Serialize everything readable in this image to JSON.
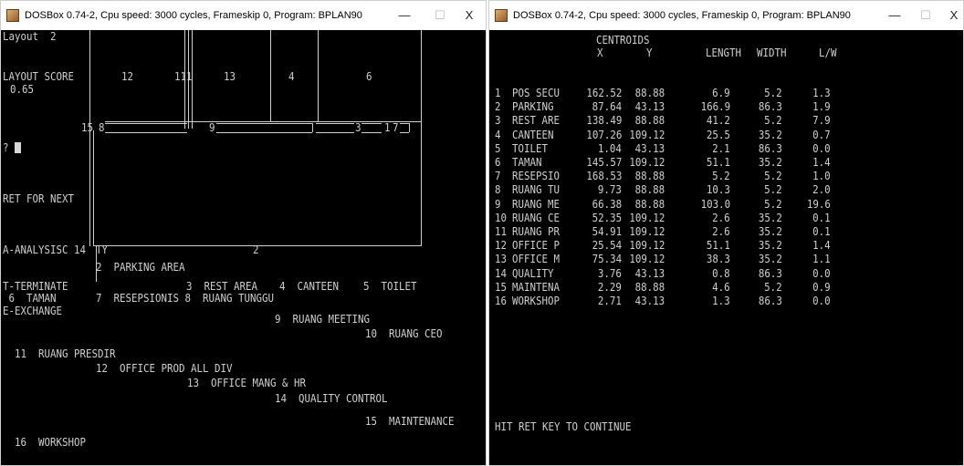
{
  "left_window": {
    "title": "DOSBox 0.74-2, Cpu speed:   3000 cycles, Frameskip  0, Program:   BPLAN90",
    "buttons": {
      "minimize": "—",
      "maximize": "☐",
      "close": "X"
    },
    "layout_label": "Layout  2",
    "score_label": "LAYOUT SCORE",
    "score_value": "0.65",
    "prompt": "?",
    "ret_for_next": "RET FOR NEXT",
    "analysis": "A-ANALYSISC 14",
    "terminate": "T-TERMINATE",
    "taman": " 6  TAMAN",
    "exchange": "E-EXCHANGE",
    "block_labels": {
      "b12": "12",
      "b111": "111",
      "b13": "13",
      "b4": "4",
      "b6": "6",
      "n15": "15",
      "n8": "8",
      "n9": "9",
      "n3": "3",
      "n1": "1",
      "n7": "7",
      "ty": "TY",
      "two": "2"
    },
    "legend": [
      "2  PARKING AREA",
      "3  REST AREA",
      "4  CANTEEN",
      "5  TOILET",
      "7  RESEPSIONIS 8  RUANG TUNGGU",
      "9  RUANG MEETING",
      "10  RUANG CEO",
      "11  RUANG PRESDIR",
      "12  OFFICE PROD ALL DIV",
      "13  OFFICE MANG & HR",
      "14  QUALITY CONTROL",
      "15  MAINTENANCE",
      "16  WORKSHOP"
    ]
  },
  "right_window": {
    "title": "DOSBox 0.74-2, Cpu speed:   3000 cycles, Frameskip  0, Program:   BPLAN90",
    "buttons": {
      "minimize": "—",
      "maximize": "☐",
      "close": "X"
    },
    "centroids_label": "CENTROIDS",
    "headers": {
      "x": "X",
      "y": "Y",
      "length": "LENGTH",
      "width": "WIDTH",
      "lw": "L/W"
    },
    "rows": [
      {
        "no": "1",
        "name": "POS SECU",
        "x": "162.52",
        "y": "88.88",
        "length": "6.9",
        "width": "5.2",
        "lw": "1.3"
      },
      {
        "no": "2",
        "name": "PARKING",
        "x": "87.64",
        "y": "43.13",
        "length": "166.9",
        "width": "86.3",
        "lw": "1.9"
      },
      {
        "no": "3",
        "name": "REST ARE",
        "x": "138.49",
        "y": "88.88",
        "length": "41.2",
        "width": "5.2",
        "lw": "7.9"
      },
      {
        "no": "4",
        "name": "CANTEEN",
        "x": "107.26",
        "y": "109.12",
        "length": "25.5",
        "width": "35.2",
        "lw": "0.7"
      },
      {
        "no": "5",
        "name": "TOILET",
        "x": "1.04",
        "y": "43.13",
        "length": "2.1",
        "width": "86.3",
        "lw": "0.0"
      },
      {
        "no": "6",
        "name": "TAMAN",
        "x": "145.57",
        "y": "109.12",
        "length": "51.1",
        "width": "35.2",
        "lw": "1.4"
      },
      {
        "no": "7",
        "name": "RESEPSIO",
        "x": "168.53",
        "y": "88.88",
        "length": "5.2",
        "width": "5.2",
        "lw": "1.0"
      },
      {
        "no": "8",
        "name": "RUANG TU",
        "x": "9.73",
        "y": "88.88",
        "length": "10.3",
        "width": "5.2",
        "lw": "2.0"
      },
      {
        "no": "9",
        "name": "RUANG ME",
        "x": "66.38",
        "y": "88.88",
        "length": "103.0",
        "width": "5.2",
        "lw": "19.6"
      },
      {
        "no": "10",
        "name": "RUANG CE",
        "x": "52.35",
        "y": "109.12",
        "length": "2.6",
        "width": "35.2",
        "lw": "0.1"
      },
      {
        "no": "11",
        "name": "RUANG PR",
        "x": "54.91",
        "y": "109.12",
        "length": "2.6",
        "width": "35.2",
        "lw": "0.1"
      },
      {
        "no": "12",
        "name": "OFFICE P",
        "x": "25.54",
        "y": "109.12",
        "length": "51.1",
        "width": "35.2",
        "lw": "1.4"
      },
      {
        "no": "13",
        "name": "OFFICE M",
        "x": "75.34",
        "y": "109.12",
        "length": "38.3",
        "width": "35.2",
        "lw": "1.1"
      },
      {
        "no": "14",
        "name": "QUALITY",
        "x": "3.76",
        "y": "43.13",
        "length": "0.8",
        "width": "86.3",
        "lw": "0.0"
      },
      {
        "no": "15",
        "name": "MAINTENA",
        "x": "2.29",
        "y": "88.88",
        "length": "4.6",
        "width": "5.2",
        "lw": "0.9"
      },
      {
        "no": "16",
        "name": "WORKSHOP",
        "x": "2.71",
        "y": "43.13",
        "length": "1.3",
        "width": "86.3",
        "lw": "0.0"
      }
    ],
    "footer": "HIT RET KEY TO CONTINUE"
  }
}
